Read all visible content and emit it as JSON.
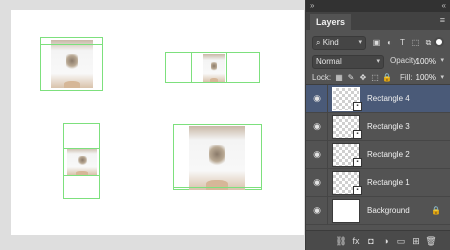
{
  "panel": {
    "collapse_glyph": "»",
    "expand_glyph": "«",
    "tab_label": "Layers",
    "menu_glyph": "≡"
  },
  "filter": {
    "kind_label": "Kind",
    "kind_glyph": "⌕",
    "icons": [
      "image-filter-icon",
      "adjustment-filter-icon",
      "type-filter-icon",
      "shape-filter-icon",
      "smart-object-filter-icon"
    ],
    "icon_glyphs": [
      "▣",
      "◐",
      "T",
      "⬚",
      "⧉"
    ]
  },
  "blend": {
    "mode": "Normal",
    "opacity_label": "Opacity:",
    "opacity_value": "100%"
  },
  "lock": {
    "label": "Lock:",
    "icon_glyphs": [
      "▦",
      "✎",
      "✥",
      "⬚",
      "🔒"
    ],
    "fill_label": "Fill:",
    "fill_value": "100%"
  },
  "layers": [
    {
      "name": "Rectangle 4",
      "selected": true,
      "type": "smart"
    },
    {
      "name": "Rectangle 3",
      "selected": false,
      "type": "smart"
    },
    {
      "name": "Rectangle 2",
      "selected": false,
      "type": "smart"
    },
    {
      "name": "Rectangle 1",
      "selected": false,
      "type": "smart"
    },
    {
      "name": "Background",
      "selected": false,
      "type": "background"
    }
  ],
  "bottom_bar": {
    "icon_glyphs": [
      "⛓",
      "fx",
      "◘",
      "◑",
      "▭",
      "⊞",
      "🗑"
    ]
  },
  "colors": {
    "panel_bg": "#535353",
    "selection": "#4a5a78",
    "guide": "#7de07d"
  }
}
